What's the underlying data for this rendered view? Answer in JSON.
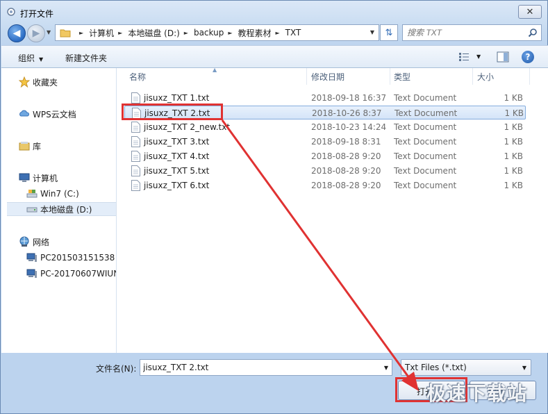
{
  "window": {
    "title": "打开文件",
    "close_glyph": "✕"
  },
  "address": {
    "breadcrumbs": [
      "计算机",
      "本地磁盘 (D:)",
      "backup",
      "教程素材",
      "TXT"
    ],
    "search_placeholder": "搜索 TXT"
  },
  "toolbar": {
    "organize_label": "组织",
    "new_folder_label": "新建文件夹",
    "help_glyph": "?"
  },
  "sidebar": {
    "items": [
      {
        "label": "收藏夹",
        "icon": "star-icon"
      },
      {
        "label": "WPS云文档",
        "icon": "cloud-icon"
      },
      {
        "label": "库",
        "icon": "library-icon"
      },
      {
        "label": "计算机",
        "icon": "computer-icon"
      },
      {
        "label": "Win7 (C:)",
        "icon": "drive-icon"
      },
      {
        "label": "本地磁盘 (D:)",
        "icon": "drive-icon",
        "selected": true
      },
      {
        "label": "网络",
        "icon": "network-icon"
      },
      {
        "label": "PC201503151538",
        "icon": "pc-icon"
      },
      {
        "label": "PC-20170607WIUN",
        "icon": "pc-icon"
      }
    ]
  },
  "columns": {
    "name": "名称",
    "modified": "修改日期",
    "type": "类型",
    "size": "大小"
  },
  "files": [
    {
      "name": "jisuxz_TXT 1.txt",
      "modified": "2018-09-18 16:37",
      "type": "Text Document",
      "size": "1 KB"
    },
    {
      "name": "jisuxz_TXT 2.txt",
      "modified": "2018-10-26 8:37",
      "type": "Text Document",
      "size": "1 KB",
      "selected": true
    },
    {
      "name": "jisuxz_TXT 2_new.txt",
      "modified": "2018-10-23 14:24",
      "type": "Text Document",
      "size": "1 KB"
    },
    {
      "name": "jisuxz_TXT 3.txt",
      "modified": "2018-09-18 8:31",
      "type": "Text Document",
      "size": "1 KB"
    },
    {
      "name": "jisuxz_TXT 4.txt",
      "modified": "2018-08-28 9:20",
      "type": "Text Document",
      "size": "1 KB"
    },
    {
      "name": "jisuxz_TXT 5.txt",
      "modified": "2018-08-28 9:20",
      "type": "Text Document",
      "size": "1 KB"
    },
    {
      "name": "jisuxz_TXT 6.txt",
      "modified": "2018-08-28 9:20",
      "type": "Text Document",
      "size": "1 KB"
    }
  ],
  "bottom": {
    "filename_label": "文件名(N):",
    "filename_value": "jisuxz_TXT 2.txt",
    "filter_value": "Txt Files (*.txt)",
    "open_label": "打开",
    "cancel_label": "取消"
  },
  "watermark": "极速下载站",
  "colors": {
    "highlight": "#e03232",
    "selection": "#d4e4f8",
    "accent": "#2b6cc4"
  }
}
